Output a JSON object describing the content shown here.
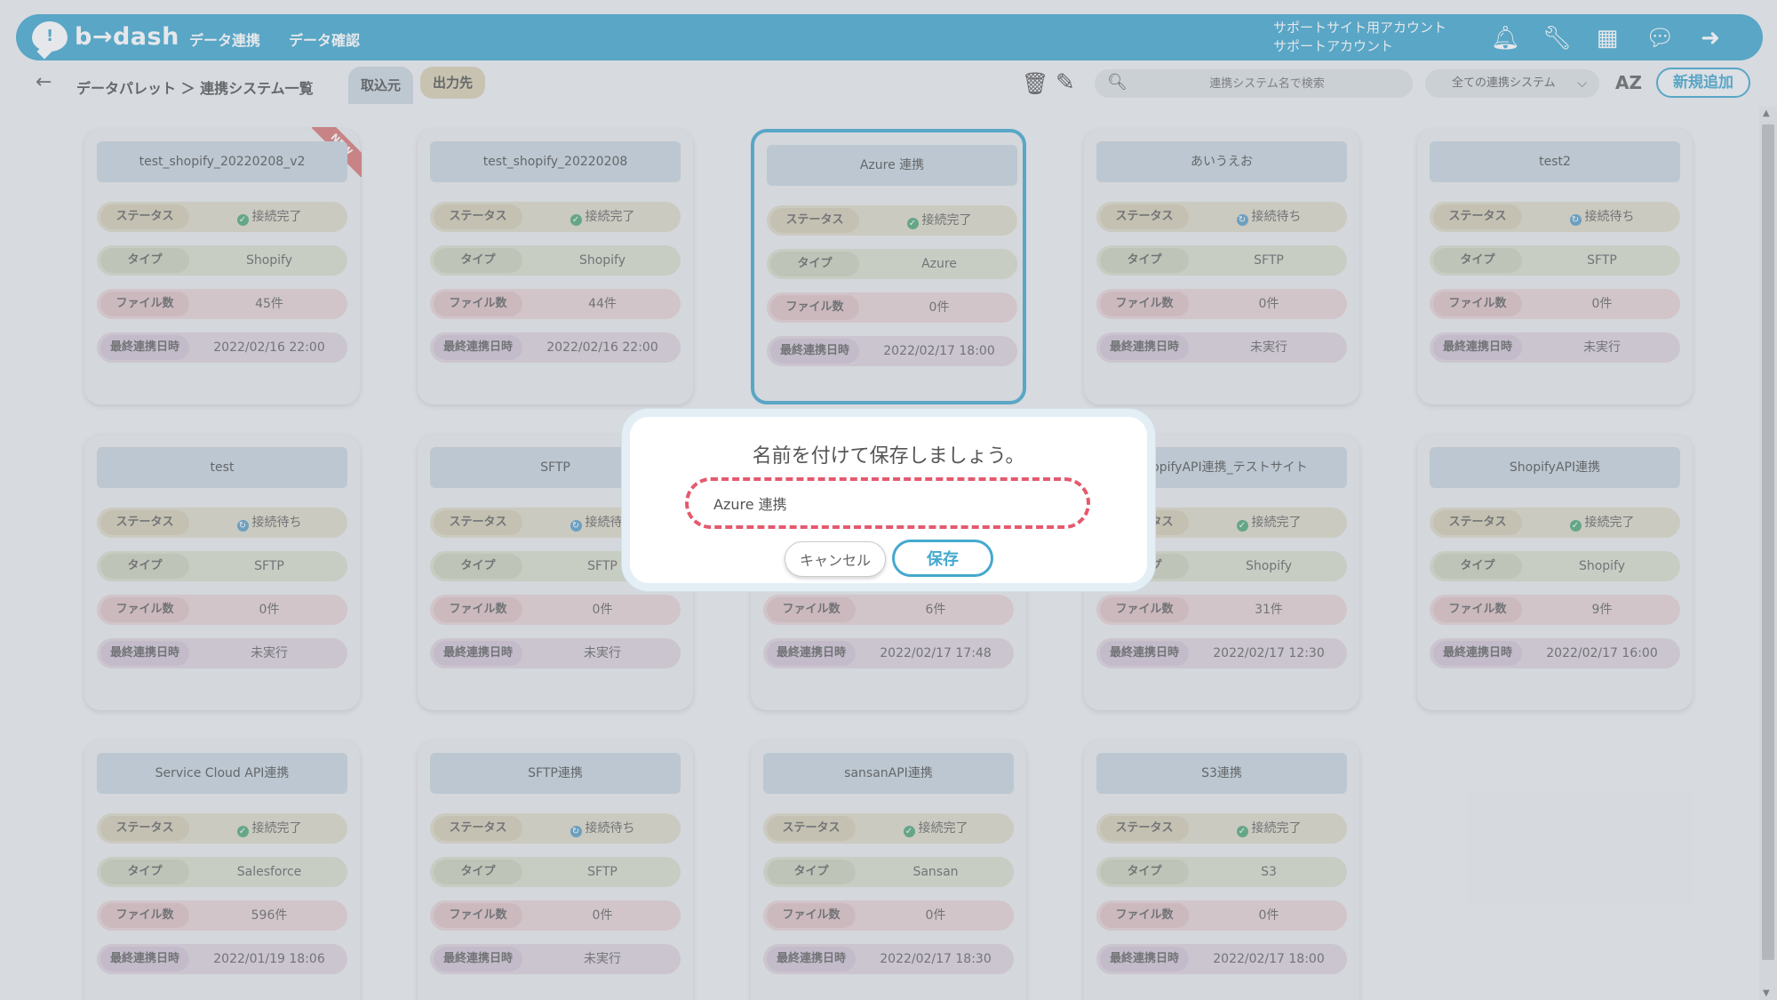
{
  "header": {
    "logo_text": "b→dash",
    "nav": [
      "データ連携",
      "データ確認"
    ],
    "account_line1": "サポートサイト用アカウント",
    "account_line2": "サポートアカウント",
    "icons": [
      "bell-icon",
      "wrench-icon",
      "grid-icon",
      "chat-icon",
      "logout-icon"
    ]
  },
  "toolbar": {
    "breadcrumb": "データパレット ＞ 連携システム一覧",
    "tab_import": "取込元",
    "tab_export": "出力先",
    "search_placeholder": "連携システム名で検索",
    "filter_value": "全ての連携システム",
    "sort_label": "AZ",
    "new_button": "新規追加"
  },
  "labels": {
    "status": "ステータス",
    "type": "タイプ",
    "files": "ファイル数",
    "last": "最終連携日時",
    "new_ribbon": "NEW"
  },
  "cards": [
    {
      "title": "test_shopify_20220208_v2",
      "status": "接続完了",
      "ok": true,
      "type": "Shopify",
      "files": "45件",
      "last": "2022/02/16 22:00",
      "new": true
    },
    {
      "title": "test_shopify_20220208",
      "status": "接続完了",
      "ok": true,
      "type": "Shopify",
      "files": "44件",
      "last": "2022/02/16 22:00"
    },
    {
      "title": "Azure 連携",
      "status": "接続完了",
      "ok": true,
      "type": "Azure",
      "files": "0件",
      "last": "2022/02/17 18:00",
      "selected": true
    },
    {
      "title": "あいうえお",
      "status": "接続待ち",
      "ok": false,
      "type": "SFTP",
      "files": "0件",
      "last": "未実行"
    },
    {
      "title": "test2",
      "status": "接続待ち",
      "ok": false,
      "type": "SFTP",
      "files": "0件",
      "last": "未実行"
    },
    {
      "title": "test",
      "status": "接続待ち",
      "ok": false,
      "type": "SFTP",
      "files": "0件",
      "last": "未実行"
    },
    {
      "title": "SFTP",
      "status": "接続待ち",
      "ok": false,
      "type": "SFTP",
      "files": "0件",
      "last": "未実行"
    },
    {
      "title": "",
      "status": "",
      "ok": true,
      "type": "",
      "files": "6件",
      "last": "2022/02/17 17:48"
    },
    {
      "title": "ShopifyAPI連携_テストサイト",
      "status": "接続完了",
      "ok": true,
      "type": "Shopify",
      "files": "31件",
      "last": "2022/02/17 12:30"
    },
    {
      "title": "ShopifyAPI連携",
      "status": "接続完了",
      "ok": true,
      "type": "Shopify",
      "files": "9件",
      "last": "2022/02/17 16:00"
    },
    {
      "title": "Service Cloud API連携",
      "status": "接続完了",
      "ok": true,
      "type": "Salesforce",
      "files": "596件",
      "last": "2022/01/19 18:06"
    },
    {
      "title": "SFTP連携",
      "status": "接続待ち",
      "ok": false,
      "type": "SFTP",
      "files": "0件",
      "last": "未実行"
    },
    {
      "title": "sansanAPI連携",
      "status": "接続完了",
      "ok": true,
      "type": "Sansan",
      "files": "0件",
      "last": "2022/02/17 18:30"
    },
    {
      "title": "S3連携",
      "status": "接続完了",
      "ok": true,
      "type": "S3",
      "files": "0件",
      "last": "2022/02/17 18:00"
    }
  ],
  "modal": {
    "title": "名前を付けて保存しましょう。",
    "input_value": "Azure 連携",
    "cancel": "キャンセル",
    "save": "保存"
  }
}
